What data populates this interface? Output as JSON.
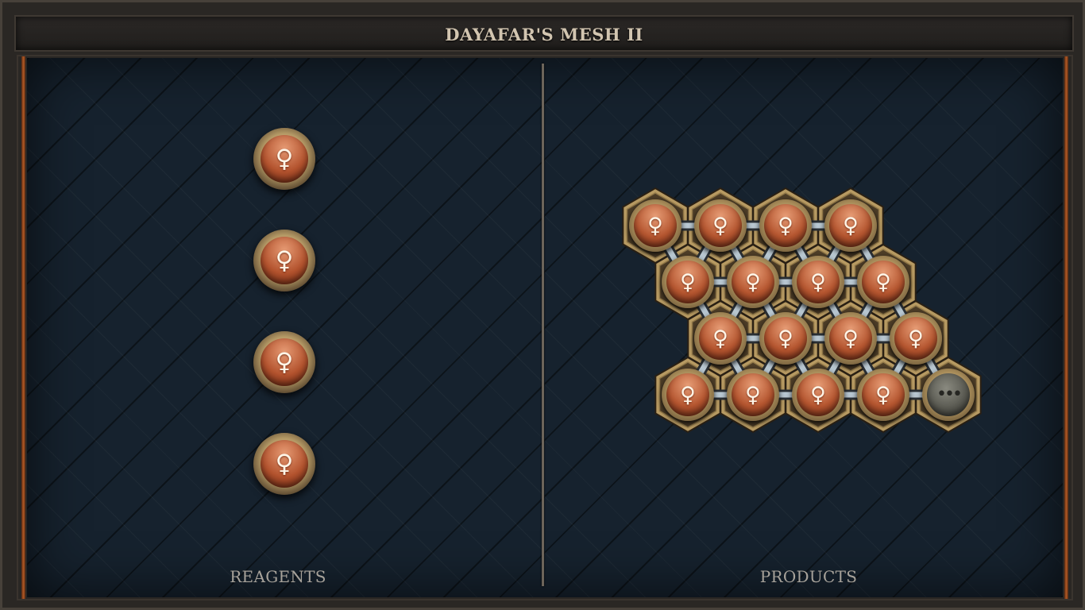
{
  "window": {
    "title": "DAYAFAR'S MESH II"
  },
  "reagents": {
    "label": "REAGENTS",
    "items": [
      {
        "symbol": "♀",
        "icon": "copper-venus-icon"
      },
      {
        "symbol": "♀",
        "icon": "copper-venus-icon"
      },
      {
        "symbol": "♀",
        "icon": "copper-venus-icon"
      },
      {
        "symbol": "♀",
        "icon": "copper-venus-icon"
      }
    ]
  },
  "products": {
    "label": "PRODUCTS",
    "mesh": {
      "rows": [
        {
          "offset": 0,
          "cells": [
            "♀",
            "♀",
            "♀",
            "♀"
          ]
        },
        {
          "offset": 0.5,
          "cells": [
            "♀",
            "♀",
            "♀",
            "♀"
          ]
        },
        {
          "offset": 1,
          "cells": [
            "♀",
            "♀",
            "♀",
            "♀"
          ]
        },
        {
          "offset": 0.5,
          "cells": [
            "♀",
            "♀",
            "♀",
            "♀",
            "•••"
          ]
        }
      ],
      "empty_symbol": "•••"
    }
  },
  "colors": {
    "copper": "#b3532e",
    "brass": "#a98d5a",
    "background": "#16222e",
    "title_text": "#d2c5b0",
    "label_text": "#a7a29a",
    "empty_slot": "#55554d"
  }
}
